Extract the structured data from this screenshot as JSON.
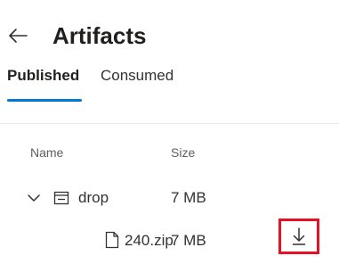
{
  "header": {
    "back_icon": "arrow-left-icon",
    "title": "Artifacts"
  },
  "tabs": [
    {
      "label": "Published",
      "selected": true
    },
    {
      "label": "Consumed",
      "selected": false
    }
  ],
  "colors": {
    "accent": "#0078d4",
    "highlight": "#e81123",
    "text": "#323130",
    "muted": "#605e5c"
  },
  "table": {
    "columns": [
      "Name",
      "Size"
    ],
    "rows": [
      {
        "name": "drop",
        "size": "7 MB",
        "icon": "folder-icon",
        "expand_icon": "chevron-down-icon"
      },
      {
        "name": "240.zip",
        "size": "7 MB",
        "icon": "file-icon",
        "action_icon": "download-icon"
      }
    ]
  }
}
